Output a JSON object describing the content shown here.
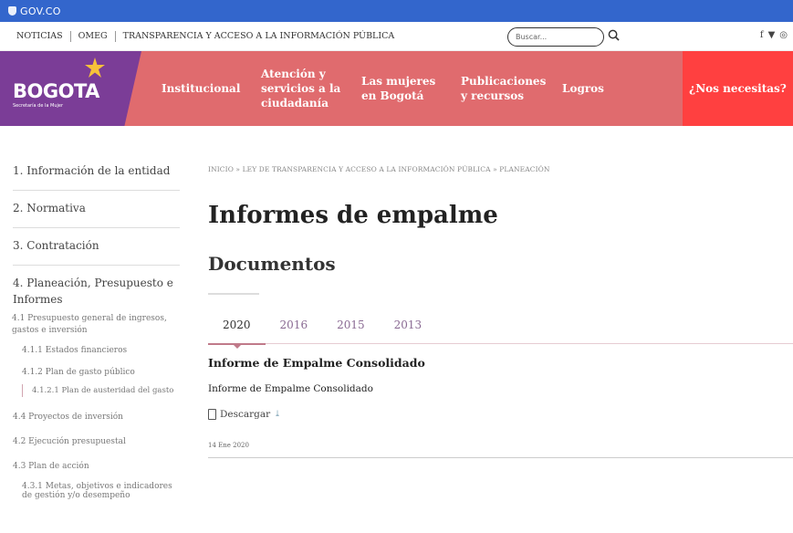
{
  "gov_bar": {
    "label": "GOV.CO"
  },
  "top_nav": {
    "links": [
      "NOTICIAS",
      "OMEG",
      "TRANSPARENCIA Y ACCESO A LA INFORMACIÓN PÚBLICA"
    ],
    "search_placeholder": "Buscar...",
    "social": [
      "f",
      "t",
      "ig"
    ]
  },
  "brand": {
    "logo_text": "BOGOTA",
    "logo_subtitle": "Secretaría de la Mujer",
    "nav": [
      "Institucional",
      "Atención y servicios a la ciudadanía",
      "Las mujeres en Bogotá",
      "Publicaciones y recursos",
      "Logros"
    ],
    "help": "¿Nos necesitas?",
    "colors": {
      "bar": "#e06b6e",
      "logo_bg": "#7b3d97",
      "help_bg": "#ff4040",
      "gov": "#3366cc"
    }
  },
  "sidebar": {
    "items": [
      "1. Información de la entidad",
      "2. Normativa",
      "3. Contratación",
      "4. Planeación, Presupuesto e Informes"
    ],
    "sub": {
      "budget": "4.1 Presupuesto general de ingresos, gastos e inversión",
      "financial": "4.1.1 Estados financieros",
      "spending_plan": "4.1.2 Plan de gasto público",
      "austerity": "4.1.2.1 Plan de austeridad del gasto",
      "projects": "4.4 Proyectos de inversión",
      "execution": "4.2 Ejecución presupuestal",
      "action_plan": "4.3 Plan de acción",
      "goals": "4.3.1 Metas, objetivos e indicadores de gestión y/o desempeño"
    }
  },
  "main": {
    "breadcrumb": "INICIO » LEY DE TRANSPARENCIA Y ACCESO A LA INFORMACIÓN PÚBLICA » PLANEACIÓN",
    "title": "Informes de empalme",
    "section": "Documentos",
    "tabs": [
      "2020",
      "2016",
      "2015",
      "2013"
    ],
    "active_tab": "2020",
    "document": {
      "title": "Informe de Empalme Consolidado",
      "description": "Informe de Empalme Consolidado",
      "download_label": "Descargar",
      "date": "14 Ene 2020"
    }
  }
}
